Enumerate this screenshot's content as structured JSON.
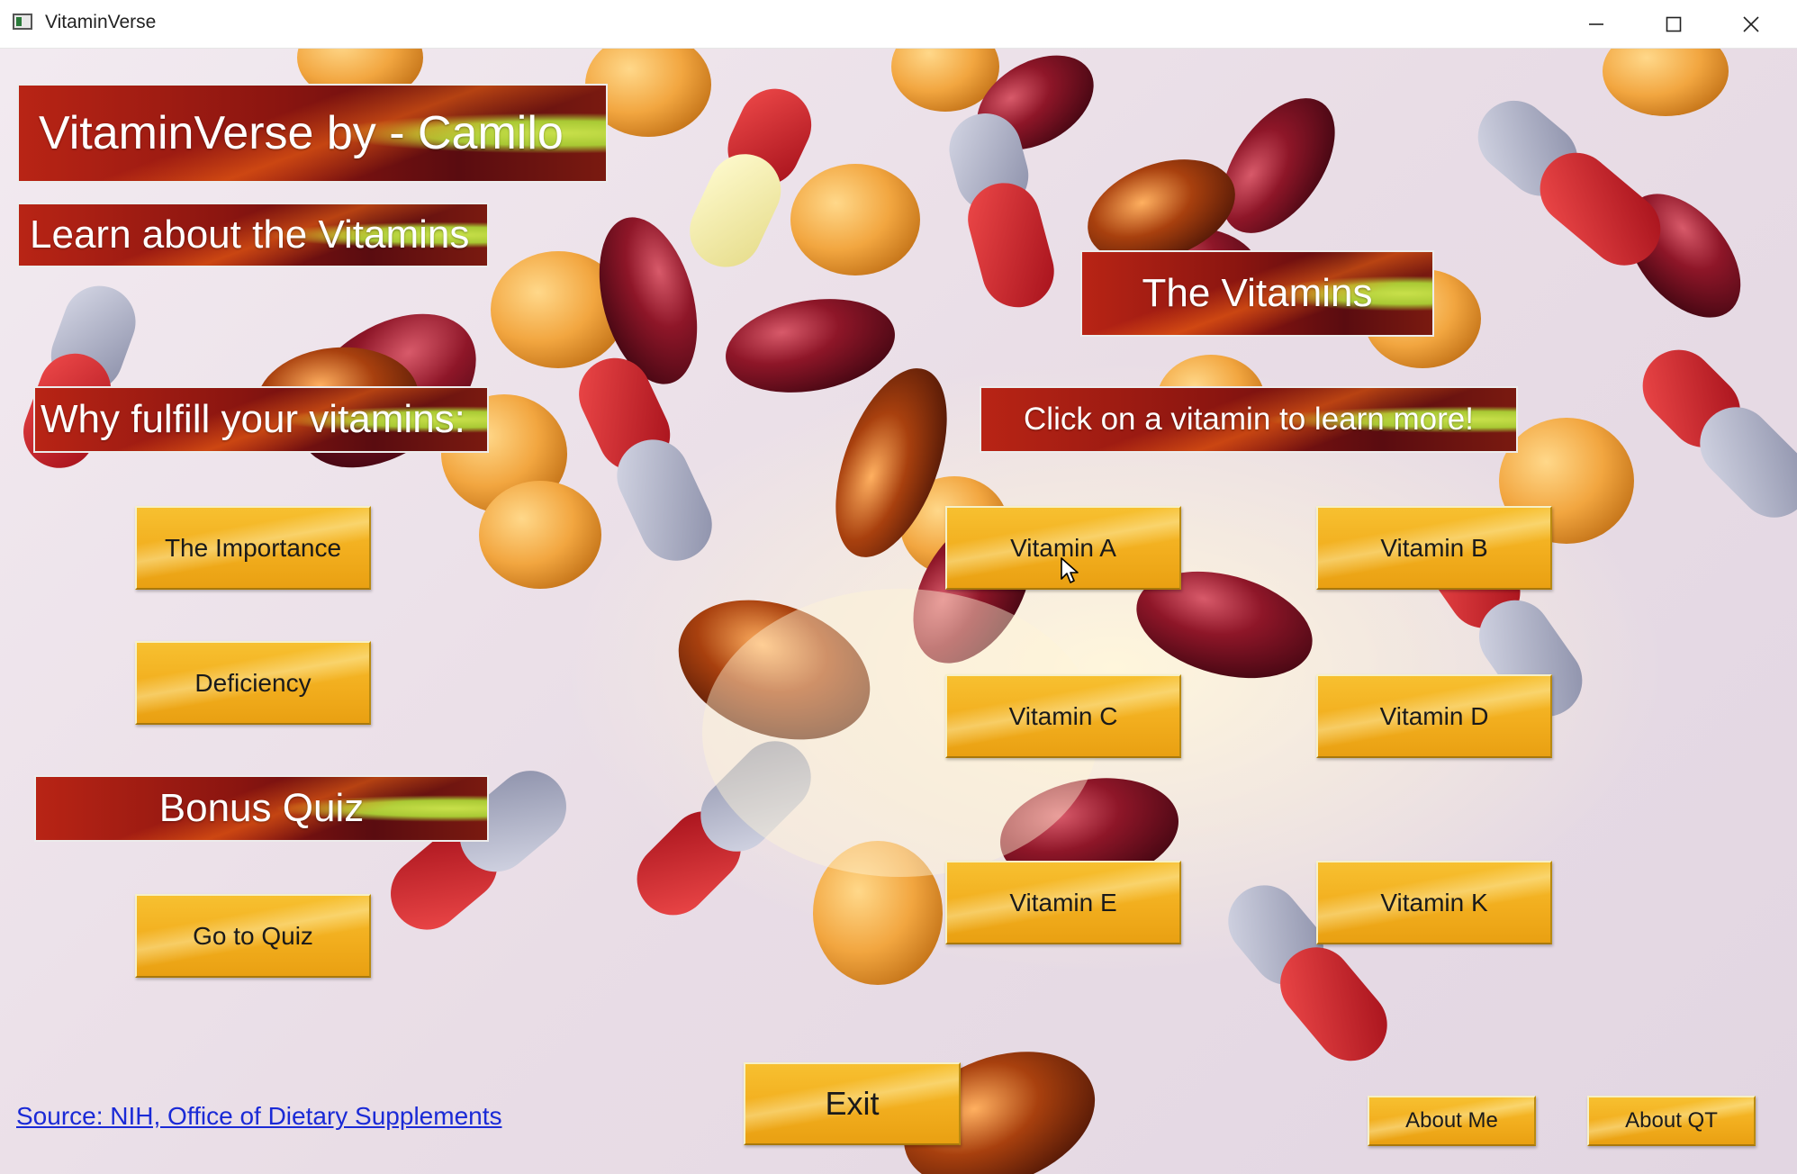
{
  "window": {
    "title": "VitaminVerse",
    "controls": [
      "minimize-icon",
      "maximize-icon",
      "close-icon"
    ]
  },
  "banners": {
    "main_title": "VitaminVerse by - Camilo",
    "learn": "Learn about the Vitamins",
    "why": "Why fulfill your vitamins:",
    "bonus": "Bonus Quiz",
    "vitamins_header": "The Vitamins",
    "click_hint": "Click on a vitamin to learn more!"
  },
  "left_buttons": {
    "importance": "The Importance",
    "deficiency": "Deficiency",
    "quiz": "Go to Quiz"
  },
  "vitamin_buttons": {
    "a": "Vitamin A",
    "b": "Vitamin B",
    "c": "Vitamin C",
    "d": "Vitamin D",
    "e": "Vitamin E",
    "k": "Vitamin K"
  },
  "footer": {
    "source": "Source: NIH, Office of Dietary Supplements ",
    "exit": "Exit",
    "about_me": "About Me",
    "about_qt": "About QT"
  },
  "colors": {
    "button_yellow": "#f2ae1e",
    "banner_red": "#8a1510",
    "banner_green": "#a9c934",
    "link_blue": "#1a2ad6"
  }
}
